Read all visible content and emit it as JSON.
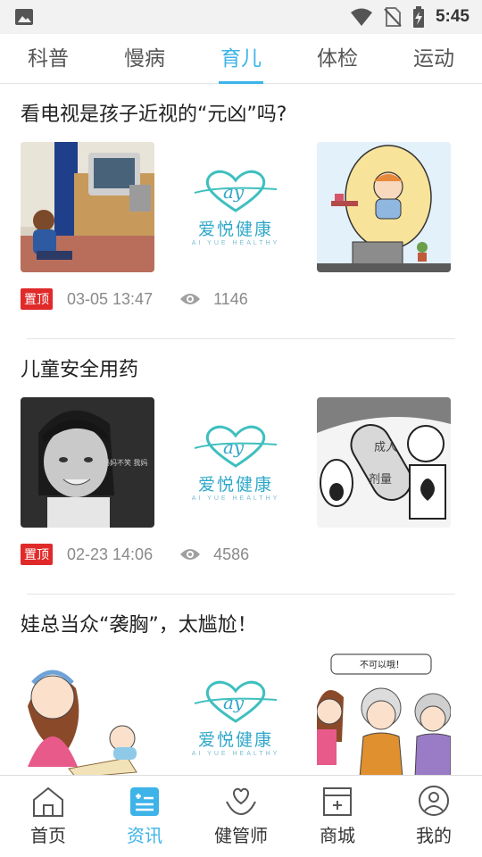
{
  "status_bar": {
    "time": "5:45",
    "icons": [
      "image-icon",
      "wifi-icon",
      "no-sim-icon",
      "battery-charging-icon"
    ]
  },
  "tabs": [
    {
      "label": "科普",
      "active": false
    },
    {
      "label": "慢病",
      "active": false
    },
    {
      "label": "育儿",
      "active": true
    },
    {
      "label": "体检",
      "active": false
    },
    {
      "label": "运动",
      "active": false
    }
  ],
  "logo": {
    "mark": "ay",
    "cn": "爱悦健康",
    "en": "AI YUE HEALTHY"
  },
  "articles": [
    {
      "title": "看电视是孩子近视的“元凶”吗?",
      "pin": "置顶",
      "date": "03-05 13:47",
      "views": "1146"
    },
    {
      "title": "儿童安全用药",
      "pin": "置顶",
      "date": "02-23 14:06",
      "views": "4586",
      "thumb1_text": "妈妈不笑 我妈",
      "thumb3_text_a": "成人",
      "thumb3_text_b": "剂量"
    },
    {
      "title": "娃总当众“袭胸”，太尴尬！",
      "thumb3_bubble": "不可以哦！"
    }
  ],
  "bottom_nav": [
    {
      "label": "首页",
      "icon": "home-icon",
      "active": false
    },
    {
      "label": "资讯",
      "icon": "news-icon",
      "active": true
    },
    {
      "label": "健管师",
      "icon": "health-manager-icon",
      "active": false
    },
    {
      "label": "商城",
      "icon": "shop-icon",
      "active": false
    },
    {
      "label": "我的",
      "icon": "profile-icon",
      "active": false
    }
  ],
  "colors": {
    "accent": "#3db3e8",
    "pin": "#e02a2a",
    "logo": "#2fa7c9"
  }
}
